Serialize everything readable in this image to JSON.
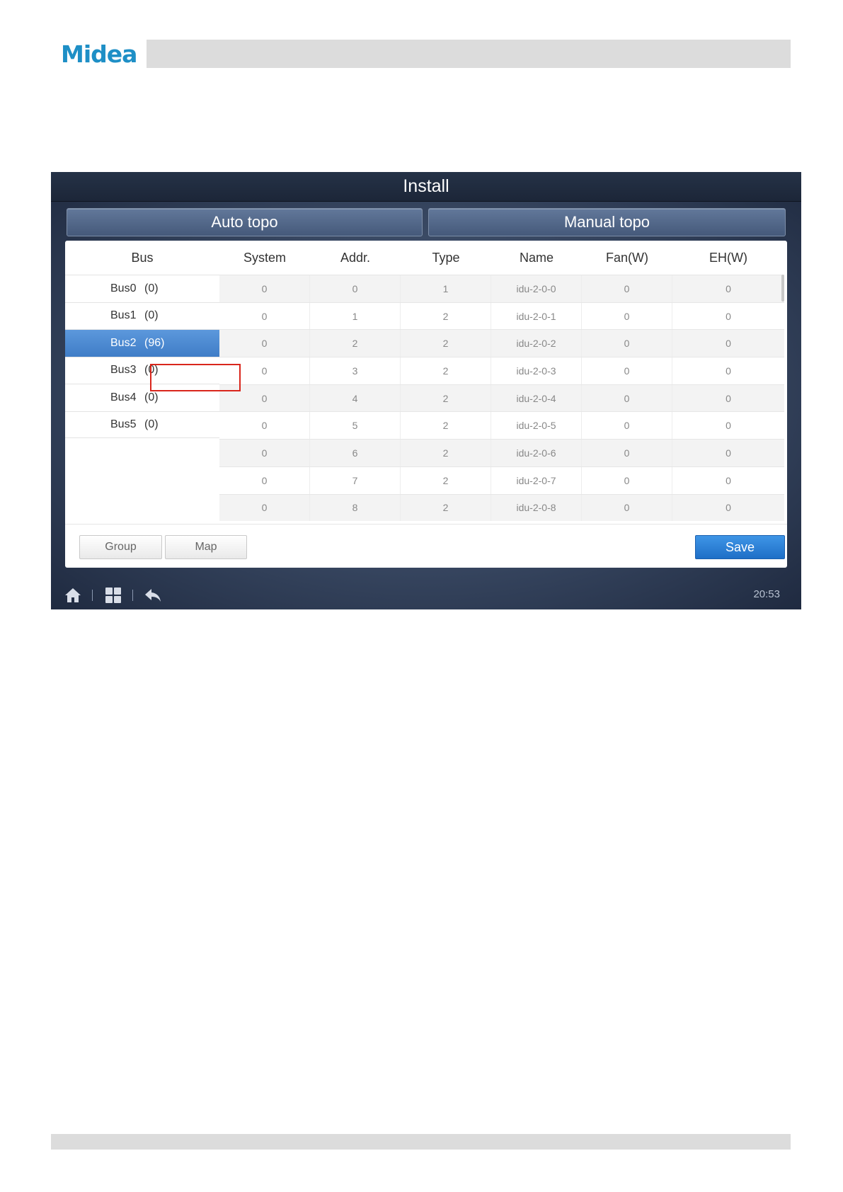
{
  "brand": {
    "logo_text": "Midea"
  },
  "screen": {
    "title": "Install",
    "tabs": {
      "auto": "Auto topo",
      "manual": "Manual topo"
    },
    "bus_header": "Bus",
    "buses": [
      {
        "name": "Bus0",
        "count": "(0)"
      },
      {
        "name": "Bus1",
        "count": "(0)"
      },
      {
        "name": "Bus2",
        "count": "(96)"
      },
      {
        "name": "Bus3",
        "count": "(0)"
      },
      {
        "name": "Bus4",
        "count": "(0)"
      },
      {
        "name": "Bus5",
        "count": "(0)"
      }
    ],
    "selected_bus": "Bus2",
    "columns": [
      "System",
      "Addr.",
      "Type",
      "Name",
      "Fan(W)",
      "EH(W)"
    ],
    "rows": [
      [
        "0",
        "0",
        "1",
        "idu-2-0-0",
        "0",
        "0"
      ],
      [
        "0",
        "1",
        "2",
        "idu-2-0-1",
        "0",
        "0"
      ],
      [
        "0",
        "2",
        "2",
        "idu-2-0-2",
        "0",
        "0"
      ],
      [
        "0",
        "3",
        "2",
        "idu-2-0-3",
        "0",
        "0"
      ],
      [
        "0",
        "4",
        "2",
        "idu-2-0-4",
        "0",
        "0"
      ],
      [
        "0",
        "5",
        "2",
        "idu-2-0-5",
        "0",
        "0"
      ],
      [
        "0",
        "6",
        "2",
        "idu-2-0-6",
        "0",
        "0"
      ],
      [
        "0",
        "7",
        "2",
        "idu-2-0-7",
        "0",
        "0"
      ],
      [
        "0",
        "8",
        "2",
        "idu-2-0-8",
        "0",
        "0"
      ]
    ],
    "buttons": {
      "group": "Group",
      "map": "Map",
      "save": "Save"
    },
    "status": {
      "time": "20:53"
    },
    "icons": [
      "home-icon",
      "apps-icon",
      "back-icon"
    ],
    "colors": {
      "accent": "#3f7dc7",
      "highlight": "#d9261c",
      "brand": "#1e8fc6"
    }
  }
}
